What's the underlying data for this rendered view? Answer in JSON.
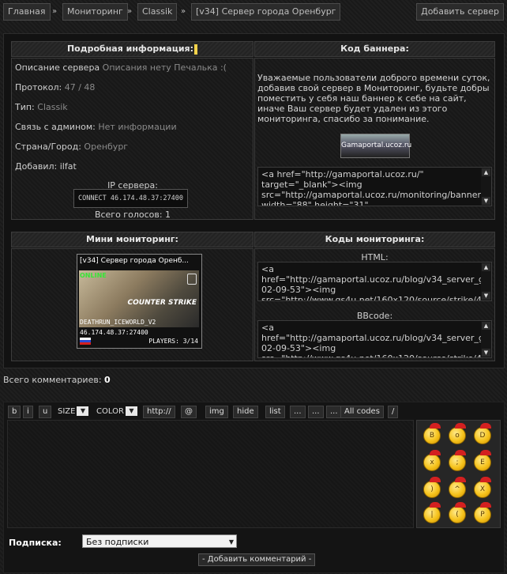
{
  "breadcrumbs": [
    "Главная",
    "Мониторинг",
    "Classik",
    "[v34] Сервер города Оренбург"
  ],
  "breadcrumb_sep": "»",
  "add_server_label": "Добавить сервер",
  "details": {
    "header": "Подробная информация:",
    "rows": [
      {
        "label": "Описание сервера",
        "value": "Описания нету Печалька :("
      },
      {
        "label": "Протокол:",
        "value": "47 / 48"
      },
      {
        "label": "Тип:",
        "value": "Classik"
      },
      {
        "label": "Связь с админом:",
        "value": "Нет информации"
      },
      {
        "label": "Страна/Город:",
        "value": "Оренбург"
      },
      {
        "label": "Добавил:",
        "value": "ilfat"
      }
    ],
    "ip_title": "IP сервера:",
    "ip_value": "CONNECT 46.174.48.37:27400",
    "votes": "Всего голосов: 1"
  },
  "banner": {
    "header": "Код баннера:",
    "notice": "Уважаемые пользователи доброго времени суток, добавив свой сервер в Мониторинг, будьте добры поместить у себя наш баннер к себе на сайт, иначе Ваш сервер будет удален из этого мониторинга, спасибо за понимание.",
    "image_text": "Gamaportal.ucoz.ru",
    "code": "<a href=\"http://gamaportal.ucoz.ru/\" target=\"_blank\"><img src=\"http://gamaportal.ucoz.ru/monitoring/banner88x31.gif\" width=\"88\" height=\"31\""
  },
  "mini": {
    "header": "Мини мониторинг:",
    "title": "[v34] Сервер города Оренб...",
    "status": "ONLINE",
    "logo": "COUNTER STRIKE",
    "map": "DEATHRUN_ICEWORLD_V2",
    "ip": "46.174.48.37:27400",
    "players": "PLAYERS: 3/14"
  },
  "codes": {
    "header": "Коды мониторинга:",
    "html_label": "HTML:",
    "html_code": " <a href=\"http://gamaportal.ucoz.ru/blog/v34_server_goroda_orenburg/2012-02-09-53\"><img src=\"http://www.gs4u.net/160x120/source/strike/46.174.48.37:27400.png \" alt=\"\"></a>",
    "bb_label": "BBcode:",
    "bb_code": " <a href=\"http://gamaportal.ucoz.ru/blog/v34_server_goroda_orenburg/2012-02-09-53\"><img src=\"http://www.gs4u.net/160x120/source/strike/46.174.48.37:27400.png \" alt=\"\"></a>"
  },
  "comments": {
    "label": "Всего комментариев:",
    "count": "0"
  },
  "toolbar": {
    "bold": "b",
    "italic": "i",
    "underline": "u",
    "size": "SIZE",
    "color": "COLOR",
    "url": "http://",
    "email": "@",
    "img": "img",
    "hide": "hide",
    "list": "list",
    "dots1": "...",
    "dots2": "...",
    "dots3": "...",
    "allcodes": "All codes",
    "close": "/",
    "dropdown_arrow": "▼"
  },
  "subscribe": {
    "label": "Подписка:",
    "selected": "Без подписки",
    "arrow": "▼"
  },
  "submit_label": "- Добавить комментарий -",
  "icons": {
    "scroll_up": "▲",
    "scroll_down": "▼"
  }
}
